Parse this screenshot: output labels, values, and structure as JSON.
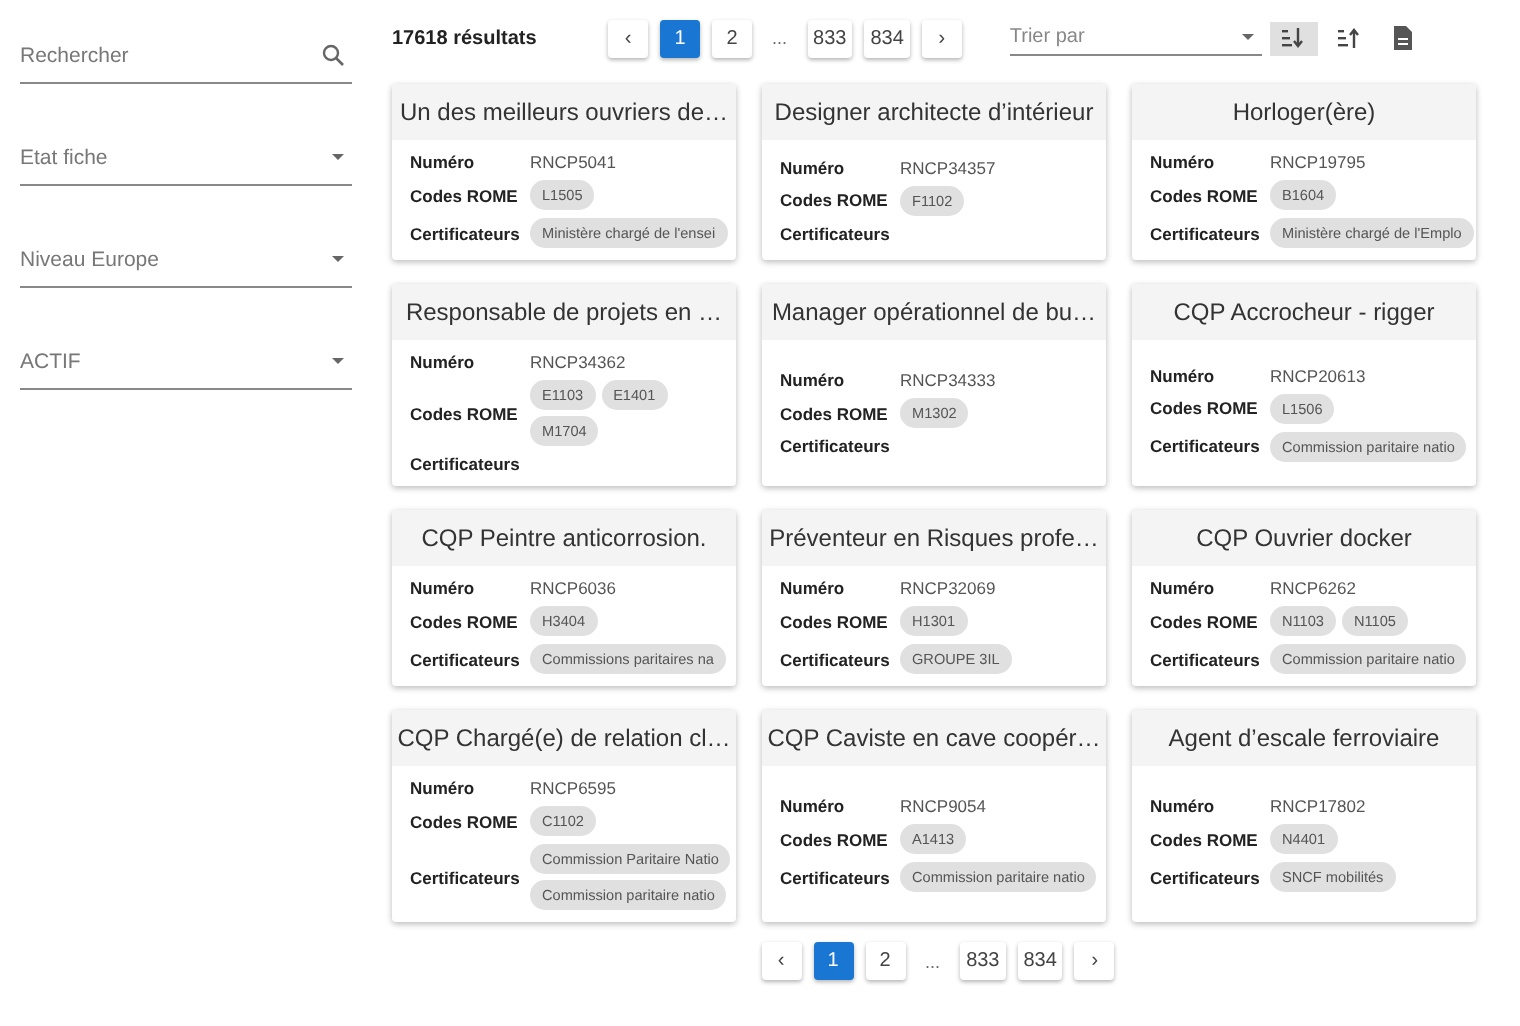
{
  "sidebar": {
    "search": {
      "placeholder": "Rechercher"
    },
    "selects": [
      {
        "placeholder": "Etat fiche"
      },
      {
        "placeholder": "Niveau Europe"
      },
      {
        "placeholder": "ACTIF"
      }
    ]
  },
  "toolbar": {
    "result_count": "17618 résultats",
    "pagination": {
      "prev": "‹",
      "next": "›",
      "ellipsis": "...",
      "pages": [
        {
          "label": "1",
          "selected": true
        },
        {
          "label": "2",
          "selected": false
        },
        {
          "label": "833",
          "selected": false
        },
        {
          "label": "834",
          "selected": false
        }
      ]
    },
    "sort": {
      "placeholder": "Trier par",
      "buttons": [
        {
          "kind": "desc",
          "selected": true
        },
        {
          "kind": "asc",
          "selected": false
        }
      ]
    }
  },
  "cards": [
    {
      "title": "Un des meilleurs ouvriers de…",
      "fields": [
        {
          "kind": "text",
          "label": "Numéro",
          "value": "RNCP5041"
        },
        {
          "kind": "chips",
          "label": "Codes ROME",
          "chips": [
            "L1505"
          ]
        },
        {
          "kind": "chips",
          "label": "Certificateurs",
          "chips": [
            "Ministère chargé de l'ensei"
          ]
        }
      ]
    },
    {
      "title": "Designer architecte d’intérieur",
      "fields": [
        {
          "kind": "text",
          "label": "Numéro",
          "value": "RNCP34357"
        },
        {
          "kind": "chips",
          "label": "Codes ROME",
          "chips": [
            "F1102"
          ]
        },
        {
          "kind": "chips",
          "label": "Certificateurs"
        }
      ]
    },
    {
      "title": "Horloger(ère)",
      "fields": [
        {
          "kind": "text",
          "label": "Numéro",
          "value": "RNCP19795"
        },
        {
          "kind": "chips",
          "label": "Codes ROME",
          "chips": [
            "B1604"
          ]
        },
        {
          "kind": "chips",
          "label": "Certificateurs",
          "chips": [
            "Ministère chargé de l'Emplo"
          ]
        }
      ]
    },
    {
      "title": "Responsable de projets en …",
      "fields": [
        {
          "kind": "text",
          "label": "Numéro",
          "value": "RNCP34362"
        },
        {
          "kind": "chips",
          "label": "Codes ROME",
          "chips": [
            "E1103",
            "E1401",
            "M1704"
          ]
        },
        {
          "kind": "chips",
          "label": "Certificateurs"
        }
      ]
    },
    {
      "title": "Manager opérationnel de bu…",
      "fields": [
        {
          "kind": "text",
          "label": "Numéro",
          "value": "RNCP34333"
        },
        {
          "kind": "chips",
          "label": "Codes ROME",
          "chips": [
            "M1302"
          ]
        },
        {
          "kind": "chips",
          "label": "Certificateurs"
        }
      ]
    },
    {
      "title": "CQP Accrocheur - rigger",
      "fields": [
        {
          "kind": "text",
          "label": "Numéro",
          "value": "RNCP20613"
        },
        {
          "kind": "chips",
          "label": "Codes ROME",
          "chips": [
            "L1506"
          ]
        },
        {
          "kind": "chips",
          "label": "Certificateurs",
          "chips": [
            "Commission paritaire natio"
          ]
        }
      ]
    },
    {
      "title": "CQP Peintre anticorrosion.",
      "fields": [
        {
          "kind": "text",
          "label": "Numéro",
          "value": "RNCP6036"
        },
        {
          "kind": "chips",
          "label": "Codes ROME",
          "chips": [
            "H3404"
          ]
        },
        {
          "kind": "chips",
          "label": "Certificateurs",
          "chips": [
            "Commissions paritaires na"
          ]
        }
      ]
    },
    {
      "title": "Préventeur en Risques profe…",
      "fields": [
        {
          "kind": "text",
          "label": "Numéro",
          "value": "RNCP32069"
        },
        {
          "kind": "chips",
          "label": "Codes ROME",
          "chips": [
            "H1301"
          ]
        },
        {
          "kind": "chips",
          "label": "Certificateurs",
          "chips": [
            "GROUPE 3IL"
          ]
        }
      ]
    },
    {
      "title": "CQP Ouvrier docker",
      "fields": [
        {
          "kind": "text",
          "label": "Numéro",
          "value": "RNCP6262"
        },
        {
          "kind": "chips",
          "label": "Codes ROME",
          "chips": [
            "N1103",
            "N1105"
          ]
        },
        {
          "kind": "chips",
          "label": "Certificateurs",
          "chips": [
            "Commission paritaire natio"
          ]
        }
      ]
    },
    {
      "title": "CQP Chargé(e) de relation cl…",
      "fields": [
        {
          "kind": "text",
          "label": "Numéro",
          "value": "RNCP6595"
        },
        {
          "kind": "chips",
          "label": "Codes ROME",
          "chips": [
            "C1102"
          ]
        },
        {
          "kind": "chips",
          "label": "Certificateurs",
          "chips": [
            "Commission Paritaire Natio",
            "Commission paritaire natio"
          ]
        }
      ]
    },
    {
      "title": "CQP Caviste en cave coopér…",
      "fields": [
        {
          "kind": "text",
          "label": "Numéro",
          "value": "RNCP9054"
        },
        {
          "kind": "chips",
          "label": "Codes ROME",
          "chips": [
            "A1413"
          ]
        },
        {
          "kind": "chips",
          "label": "Certificateurs",
          "chips": [
            "Commission paritaire natio"
          ]
        }
      ]
    },
    {
      "title": "Agent d’escale ferroviaire",
      "fields": [
        {
          "kind": "text",
          "label": "Numéro",
          "value": "RNCP17802"
        },
        {
          "kind": "chips",
          "label": "Codes ROME",
          "chips": [
            "N4401"
          ]
        },
        {
          "kind": "chips",
          "label": "Certificateurs",
          "chips": [
            "SNCF mobilités"
          ]
        }
      ]
    }
  ],
  "bottom_pagination": {
    "prev": "‹",
    "next": "›",
    "ellipsis": "...",
    "pages": [
      {
        "label": "1",
        "selected": true
      },
      {
        "label": "2",
        "selected": false
      },
      {
        "label": "833",
        "selected": false
      },
      {
        "label": "834",
        "selected": false
      }
    ]
  }
}
